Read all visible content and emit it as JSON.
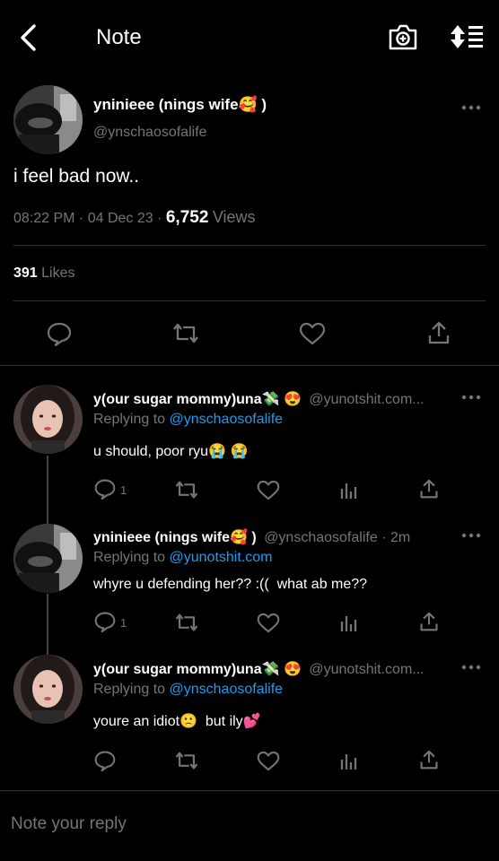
{
  "header": {
    "title": "Note",
    "back_icon": "chevron-left-icon",
    "camera_icon": "camera-plus-icon",
    "sort_icon": "sort-icon"
  },
  "tweet": {
    "display_name": "yninieee (nings wife🥰 )",
    "handle": "@ynschaosofalife",
    "text": "i feel bad now..",
    "time": "08:22 PM · 04 Dec 23 · ",
    "views_count": "6,752",
    "views_label": "Views",
    "likes_count": "391",
    "likes_label": "Likes"
  },
  "replies": [
    {
      "display_name": "y(our sugar mommy)una💸 😍",
      "meta": "@yunotshit.com...",
      "replying_prefix": "Replying to",
      "replying_to": "@ynschaosofalife",
      "text": "u should, poor ryu😭 😭",
      "reply_count": "1"
    },
    {
      "display_name": "yninieee (nings wife🥰 )",
      "meta": "@ynschaosofalife · 2m",
      "replying_prefix": "Replying to",
      "replying_to": "@yunotshit.com",
      "text": "whyre u defending her?? :((  what ab me??",
      "reply_count": "1"
    },
    {
      "display_name": "y(our sugar mommy)una💸 😍",
      "meta": "@yunotshit.com...",
      "replying_prefix": "Replying to",
      "replying_to": "@ynschaosofalife",
      "text": "youre an idiot🙁  but ily💕",
      "reply_count": ""
    }
  ],
  "composer": {
    "placeholder": "Note your reply"
  },
  "colors": {
    "background": "#000000",
    "text": "#e7e9ea",
    "muted": "#71767b",
    "link": "#1d9bf0",
    "divider": "#2f3336"
  }
}
